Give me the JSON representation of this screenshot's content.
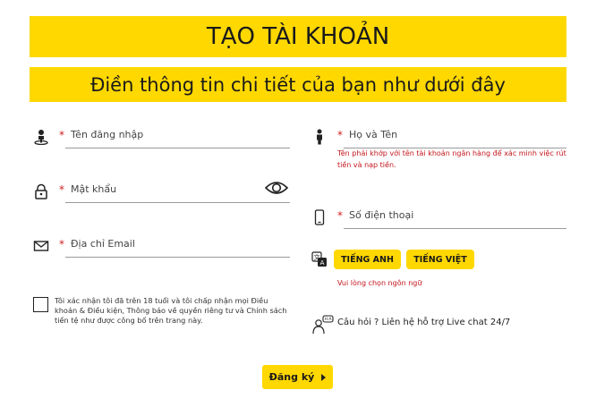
{
  "header": {
    "title": "TẠO TÀI KHOẢN",
    "subtitle": "Điền thông tin chi tiết của bạn như dưới đây"
  },
  "form": {
    "required_mark": "*",
    "username": {
      "placeholder": "Tên đăng nhập",
      "icon": "user-pin-icon"
    },
    "password": {
      "placeholder": "Mật khẩu",
      "icon": "lock-icon",
      "toggle_icon": "eye-icon"
    },
    "email": {
      "placeholder": "Địa chỉ Email",
      "icon": "envelope-icon"
    },
    "fullname": {
      "placeholder": "Họ và Tên",
      "icon": "person-icon",
      "hint": "Tên phải khớp với tên tài khoản ngân hàng để xác minh việc rút tiền và nạp tiền."
    },
    "phone": {
      "placeholder": "Số điện thoại",
      "icon": "phone-icon"
    },
    "language": {
      "icon": "translate-icon",
      "options": [
        "TIẾNG ANH",
        "TIẾNG VIỆT"
      ],
      "error": "Vui lòng chọn ngôn ngữ"
    },
    "terms": "Tôi xác nhận tôi đã trên 18 tuổi và tôi chấp nhận mọi Điều khoản & Điều kiện, Thông báo về quyền riêng tư và Chính sách tiền tệ như được công bố trên trang này.",
    "help": {
      "icon": "chat-support-icon",
      "text": "Câu hỏi ? Liên hệ hỗ trợ Live chat 24/7"
    },
    "submit_label": "Đăng ký"
  },
  "colors": {
    "accent": "#ffd800",
    "error": "#c4161c"
  }
}
